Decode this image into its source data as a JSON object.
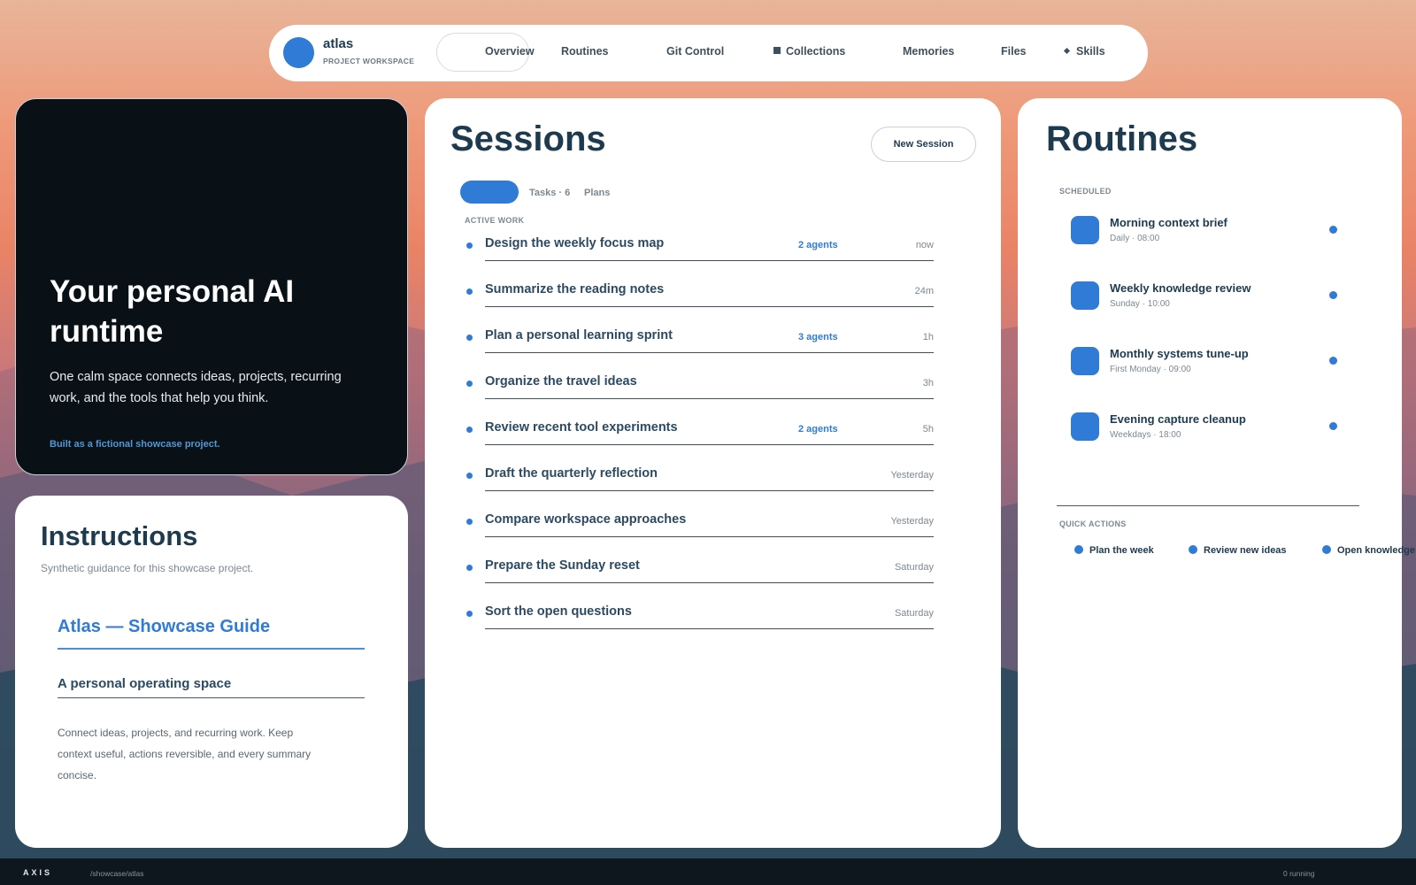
{
  "nav": {
    "workspace_name": "atlas",
    "workspace_type": "PROJECT WORKSPACE",
    "items": [
      "Overview",
      "Routines",
      "Git Control",
      "Collections",
      "Memories",
      "Files",
      "Skills"
    ],
    "active": "Overview"
  },
  "hero": {
    "title": "Your personal AI runtime",
    "body": "One calm space connects ideas, projects, recurring work, and the tools that help you think.",
    "note": "Built as a fictional showcase project."
  },
  "instructions": {
    "title": "Instructions",
    "subtitle": "Synthetic guidance for this showcase project.",
    "guide_title": "Atlas — Showcase Guide",
    "guide_heading": "A personal operating space",
    "guide_body": "Connect ideas, projects, and recurring work. Keep context useful, actions reversible, and every summary concise."
  },
  "sessions": {
    "title": "Sessions",
    "new_button": "New Session",
    "tabs": [
      "",
      "Tasks · 6",
      "Plans"
    ],
    "section_label": "ACTIVE WORK",
    "rows": [
      {
        "name": "Design the weekly focus map",
        "agents": "2 agents",
        "time": "now"
      },
      {
        "name": "Summarize the reading notes",
        "agents": "",
        "time": "24m"
      },
      {
        "name": "Plan a personal learning sprint",
        "agents": "3 agents",
        "time": "1h"
      },
      {
        "name": "Organize the travel ideas",
        "agents": "",
        "time": "3h"
      },
      {
        "name": "Review recent tool experiments",
        "agents": "2 agents",
        "time": "5h"
      },
      {
        "name": "Draft the quarterly reflection",
        "agents": "",
        "time": "Yesterday"
      },
      {
        "name": "Compare workspace approaches",
        "agents": "",
        "time": "Yesterday"
      },
      {
        "name": "Prepare the Sunday reset",
        "agents": "",
        "time": "Saturday"
      },
      {
        "name": "Sort the open questions",
        "agents": "",
        "time": "Saturday"
      }
    ]
  },
  "routines": {
    "title": "Routines",
    "scheduled_label": "SCHEDULED",
    "items": [
      {
        "name": "Morning context brief",
        "schedule": "Daily · 08:00"
      },
      {
        "name": "Weekly knowledge review",
        "schedule": "Sunday · 10:00"
      },
      {
        "name": "Monthly systems tune-up",
        "schedule": "First Monday · 09:00"
      },
      {
        "name": "Evening capture cleanup",
        "schedule": "Weekdays · 18:00"
      }
    ],
    "quick_label": "QUICK ACTIONS",
    "quick_actions": [
      "Plan the week",
      "Review new ideas",
      "Open knowledge"
    ]
  },
  "footer": {
    "brand": "AXIS",
    "path": "/showcase/atlas",
    "status": "0 running"
  },
  "colors": {
    "accent": "#2f7bd6",
    "heading": "#1d3a4f",
    "hero_bg": "#0a1116",
    "footer_bg": "#0e171d"
  }
}
